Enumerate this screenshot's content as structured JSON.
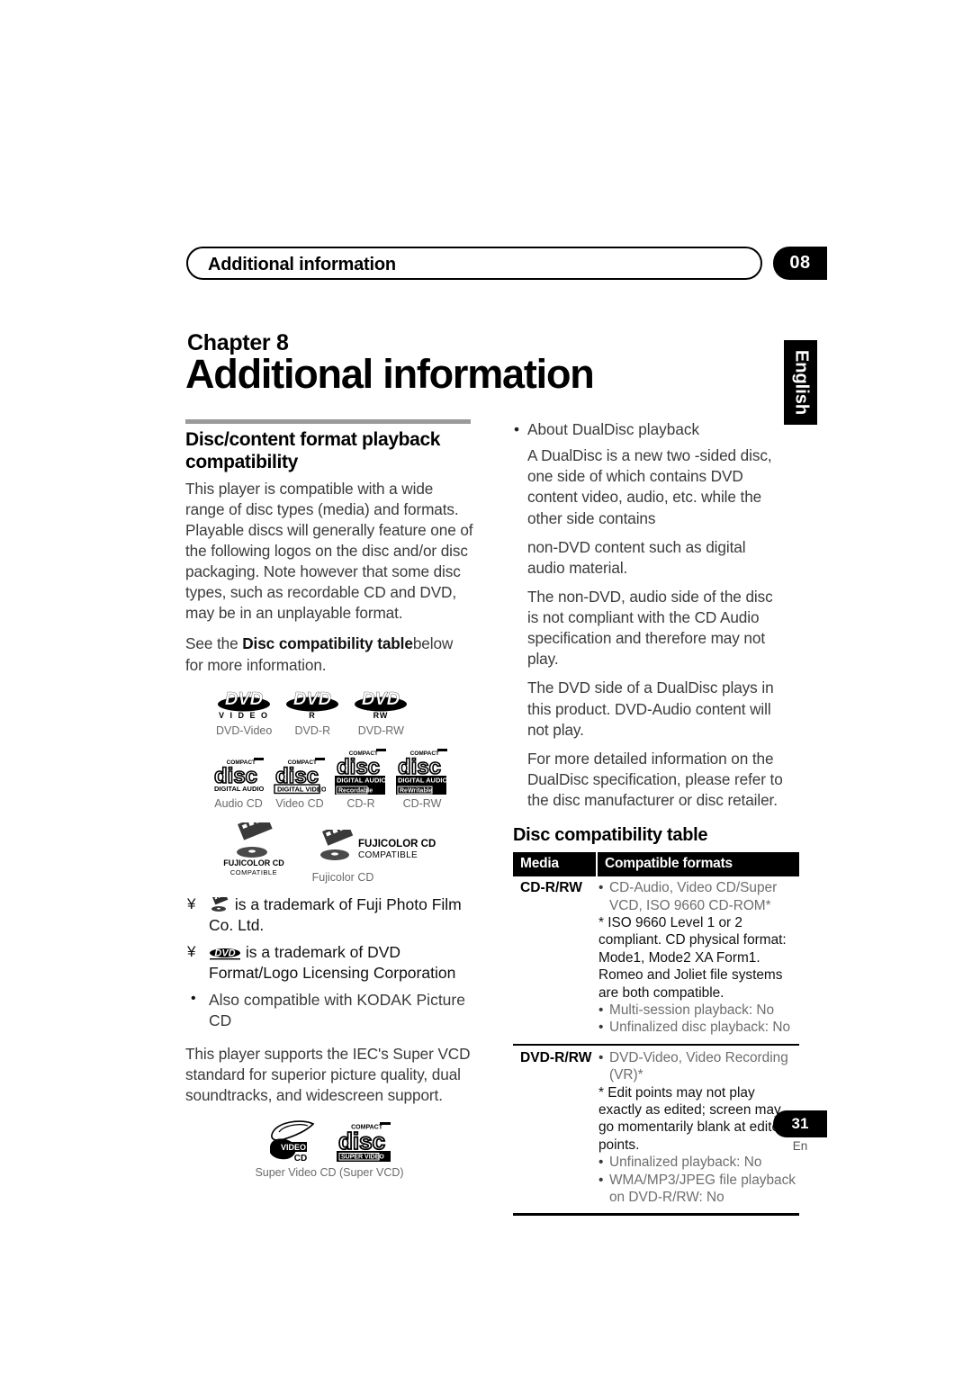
{
  "header": {
    "running_title": "Additional information",
    "chapter_number": "08"
  },
  "language_tab": "English",
  "chapter": {
    "label": "Chapter 8",
    "title": "Additional information"
  },
  "left_column": {
    "section_heading": "Disc/content format playback compatibility",
    "paragraph_1": "This player is compatible with a wide range of disc types (media) and formats. Playable discs will generally feature one of the following logos on the disc and/or disc packaging. Note however that some disc types, such as recordable CD and DVD, may be in an unplayable format.",
    "paragraph_2_prefix": "See the ",
    "paragraph_2_bold": "Disc compatibility table",
    "paragraph_2_suffix": "below for more information.",
    "dvd_logos": [
      {
        "mark": "DVD",
        "sub": "V I D E O",
        "caption": "DVD-Video"
      },
      {
        "mark": "DVD",
        "sub": "R",
        "caption": "DVD-R"
      },
      {
        "mark": "DVD",
        "sub": "RW",
        "caption": "DVD-RW"
      }
    ],
    "cd_logos": [
      {
        "top": "COMPACT",
        "word": "disc",
        "band": "DIGITAL AUDIO",
        "band2": "",
        "caption": "Audio CD"
      },
      {
        "top": "COMPACT",
        "word": "disc",
        "band": "DIGITAL VIDEO",
        "band2": "",
        "caption": "Video CD"
      },
      {
        "top": "COMPACT",
        "word": "disc",
        "band": "DIGITAL AUDIO",
        "band2": "Recordable",
        "caption": "CD-R"
      },
      {
        "top": "COMPACT",
        "word": "disc",
        "band": "DIGITAL AUDIO",
        "band2": "ReWritable",
        "caption": "CD-RW"
      }
    ],
    "fujicolor": {
      "mark_line1": "FUJICOLOR CD",
      "mark_line2": "COMPATIBLE",
      "caption": "Fujicolor CD"
    },
    "trademarks": [
      {
        "bullet": "¥",
        "icon": "fujicolor-mark",
        "text": "is a trademark of Fuji Photo Film Co. Ltd."
      },
      {
        "bullet": "¥",
        "icon": "dvd-mark",
        "text": "is a trademark of DVD Format/Logo Licensing Corporation"
      }
    ],
    "kodak_note": {
      "bullet": "•",
      "text": "Also compatible with KODAK Picture CD"
    },
    "svcd_paragraph": "This player supports the IEC's Super VCD standard for superior picture quality, dual soundtracks, and widescreen support.",
    "svcd_logo": {
      "video_cd_line1": "VIDEO",
      "video_cd_line2": "CD",
      "compact_top": "COMPACT",
      "compact_word": "disc",
      "compact_band": "SUPER VIDEO",
      "caption": "Super Video CD (Super VCD)"
    }
  },
  "right_column": {
    "dualdisc_bullet": "•",
    "dualdisc_heading": "About DualDisc playback",
    "dualdisc_paragraphs": [
      "A DualDisc is a new two -sided disc, one side of which contains DVD content video, audio, etc. while the other side contains",
      "non-DVD content such as digital audio material.",
      "The non-DVD, audio side of the disc is not compliant with the CD Audio specification and therefore may not play.",
      "The DVD side of a DualDisc plays in this product. DVD-Audio content will not play.",
      "For more detailed information on the DualDisc specification, please refer to the disc manufacturer or disc retailer."
    ],
    "table_heading": "Disc compatibility table",
    "table": {
      "columns": [
        "Media",
        "Compatible formats"
      ],
      "rows": [
        {
          "media": "CD-R/RW",
          "bullets": [
            "CD-Audio, Video CD/Super VCD, ISO 9660 CD-ROM*"
          ],
          "note": "* ISO 9660 Level 1 or 2 compliant. CD physical format: Mode1, Mode2 XA Form1. Romeo and Joliet file systems are both compatible.",
          "bullets_after": [
            "Multi-session playback: No",
            "Unfinalized disc playback: No"
          ]
        },
        {
          "media": "DVD-R/RW",
          "bullets": [
            "DVD-Video, Video Recording (VR)*"
          ],
          "note": "* Edit points may not play exactly as edited; screen may go momentarily blank at edited points.",
          "bullets_after": [
            "Unfinalized playback: No",
            "WMA/MP3/JPEG file playback on DVD-R/RW: No"
          ]
        }
      ]
    }
  },
  "footer": {
    "page_number": "31",
    "language_code": "En"
  }
}
